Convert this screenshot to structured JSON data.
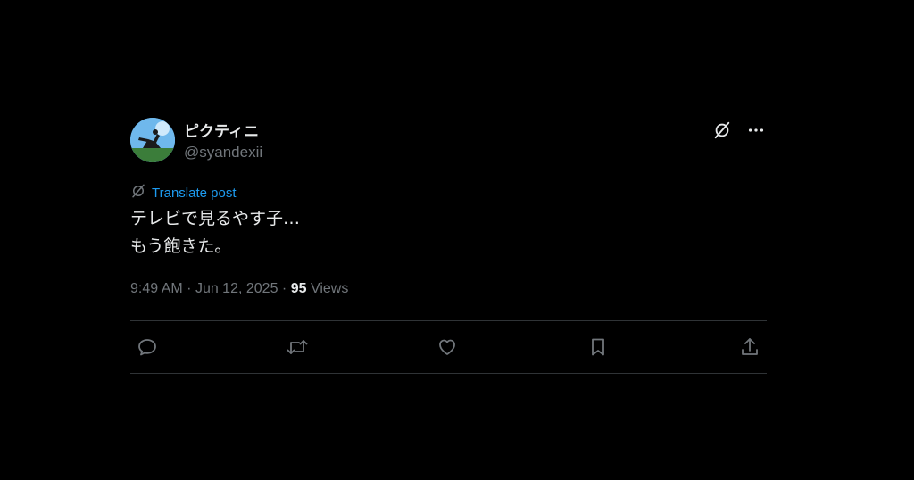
{
  "post": {
    "author": {
      "display_name": "ピクティニ",
      "handle": "@syandexii"
    },
    "translate_label": "Translate post",
    "text_lines": [
      "テレビで見るやす子…",
      "もう飽きた。"
    ],
    "time": "9:49 AM",
    "separator": "·",
    "date": "Jun 12, 2025",
    "views_count": "95",
    "views_label": "Views"
  },
  "icons": {
    "grok": "grok-icon",
    "more": "more-icon",
    "translate": "translate-icon",
    "reply": "reply-icon",
    "repost": "repost-icon",
    "like": "like-icon",
    "bookmark": "bookmark-icon",
    "share": "share-icon"
  },
  "colors": {
    "background": "#000000",
    "text": "#e7e9ea",
    "secondary": "#71767b",
    "link": "#1d9bf0",
    "divider": "#2f3336"
  }
}
